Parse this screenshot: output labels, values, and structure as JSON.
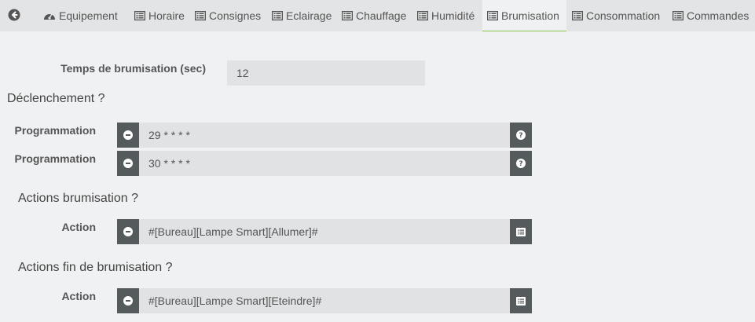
{
  "tabs": [
    {
      "label": "Equipement",
      "icon": "gauge-icon"
    },
    {
      "label": "Horaire",
      "icon": "list-icon"
    },
    {
      "label": "Consignes",
      "icon": "list-icon"
    },
    {
      "label": "Eclairage",
      "icon": "list-icon"
    },
    {
      "label": "Chauffage",
      "icon": "list-icon"
    },
    {
      "label": "Humidité",
      "icon": "list-icon"
    },
    {
      "label": "Brumisation",
      "icon": "list-icon",
      "active": true
    },
    {
      "label": "Consommation",
      "icon": "list-icon"
    },
    {
      "label": "Commandes",
      "icon": "list-icon"
    }
  ],
  "brumisation": {
    "duration_label": "Temps de brumisation (sec)",
    "duration_value": "12",
    "trigger_title": "Déclenchement ?",
    "schedules": [
      {
        "label": "Programmation",
        "value": "29 * * * *"
      },
      {
        "label": "Programmation",
        "value": "30 * * * *"
      }
    ],
    "actions_title": "Actions brumisation ?",
    "actions": [
      {
        "label": "Action",
        "value": "#[Bureau][Lampe Smart][Allumer]#"
      }
    ],
    "end_actions_title": "Actions fin de brumisation ?",
    "end_actions": [
      {
        "label": "Action",
        "value": "#[Bureau][Lampe Smart][Eteindre]#"
      }
    ]
  },
  "colors": {
    "accent": "#8bc34a",
    "button_dark": "#555a5c",
    "field_bg": "#e1e2e3",
    "tabbar_bg": "#e3e4e5",
    "page_bg": "#f0f1f2"
  }
}
